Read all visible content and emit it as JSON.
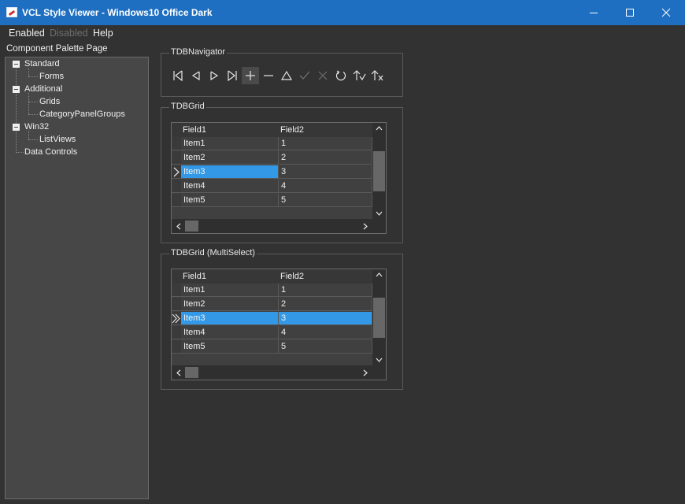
{
  "window": {
    "title": "VCL Style Viewer - Windows10 Office Dark",
    "accent_color": "#1e6fc1"
  },
  "menu": [
    {
      "label": "Enabled",
      "disabled": false
    },
    {
      "label": "Disabled",
      "disabled": true
    },
    {
      "label": "Help",
      "disabled": false
    }
  ],
  "palette": {
    "label": "Component Palette Page",
    "tree": [
      {
        "label": "Standard",
        "level": 0,
        "expanded": true
      },
      {
        "label": "Forms",
        "level": 1
      },
      {
        "label": "Additional",
        "level": 0,
        "expanded": true
      },
      {
        "label": "Grids",
        "level": 1
      },
      {
        "label": "CategoryPanelGroups",
        "level": 1
      },
      {
        "label": "Win32",
        "level": 0,
        "expanded": true
      },
      {
        "label": "ListViews",
        "level": 1
      },
      {
        "label": "Data Controls",
        "level": 0
      }
    ]
  },
  "navigator": {
    "caption": "TDBNavigator",
    "buttons": [
      "first-icon",
      "prior-icon",
      "next-icon",
      "last-icon",
      "insert-icon",
      "delete-icon",
      "edit-icon",
      "post-icon",
      "cancel-icon",
      "refresh-icon",
      "apply-updates-icon",
      "cancel-updates-icon"
    ]
  },
  "grid1": {
    "caption": "TDBGrid",
    "columns": [
      "Field1",
      "Field2"
    ],
    "rows": [
      [
        "Item1",
        "1"
      ],
      [
        "Item2",
        "2"
      ],
      [
        "Item3",
        "3"
      ],
      [
        "Item4",
        "4"
      ],
      [
        "Item5",
        "5"
      ]
    ],
    "selected_index": 2,
    "selection_color": "#3399e6"
  },
  "grid2": {
    "caption": "TDBGrid (MultiSelect)",
    "columns": [
      "Field1",
      "Field2"
    ],
    "rows": [
      [
        "Item1",
        "1"
      ],
      [
        "Item2",
        "2"
      ],
      [
        "Item3",
        "3"
      ],
      [
        "Item4",
        "4"
      ],
      [
        "Item5",
        "5"
      ]
    ],
    "selected_index": 2,
    "selection_color": "#3399e6"
  }
}
